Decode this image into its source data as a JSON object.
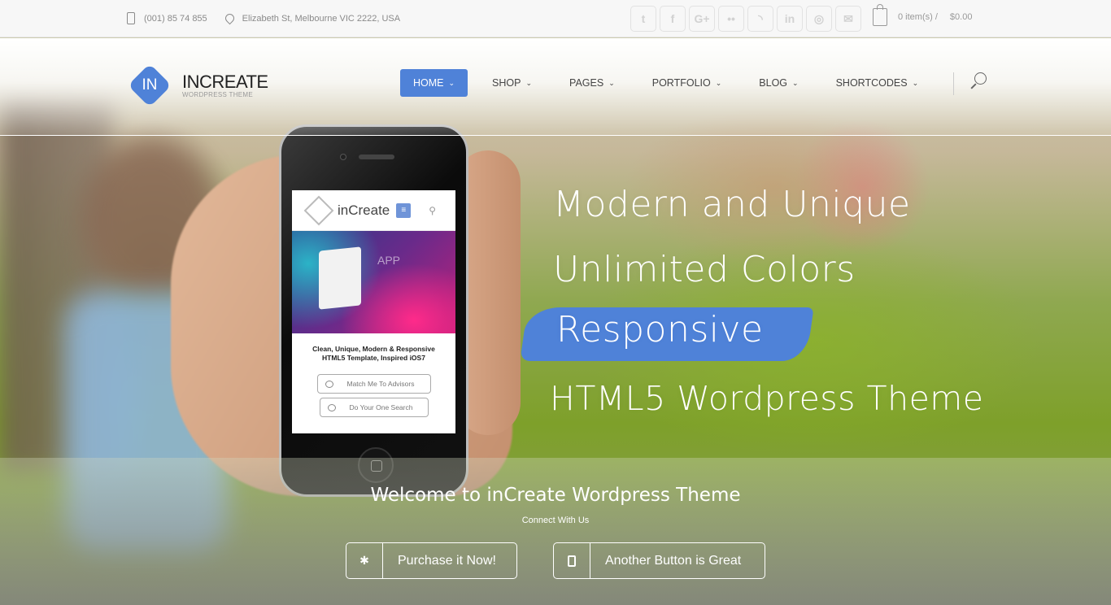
{
  "topbar": {
    "phone": "(001) 85 74 855",
    "address": "Elizabeth St, Melbourne VIC 2222, USA",
    "socials": [
      {
        "name": "twitter",
        "glyph": "t"
      },
      {
        "name": "facebook",
        "glyph": "f"
      },
      {
        "name": "google-plus",
        "glyph": "G+"
      },
      {
        "name": "flickr",
        "glyph": "••"
      },
      {
        "name": "rss",
        "glyph": "◝"
      },
      {
        "name": "linkedin",
        "glyph": "in"
      },
      {
        "name": "dribbble",
        "glyph": "◎"
      },
      {
        "name": "email",
        "glyph": "✉"
      }
    ],
    "cart_items": "0 item(s) /",
    "cart_total": "$0.00"
  },
  "header": {
    "logo_mark": "IN",
    "logo_title": "INCREATE",
    "logo_subtitle": "WORDPRESS THEME",
    "nav": [
      {
        "label": "HOME",
        "active": true
      },
      {
        "label": "SHOP"
      },
      {
        "label": "PAGES"
      },
      {
        "label": "PORTFOLIO"
      },
      {
        "label": "BLOG"
      },
      {
        "label": "SHORTCODES"
      }
    ],
    "chevron": "⌄"
  },
  "phone_screen": {
    "title": "inCreate",
    "menu_glyph": "≡",
    "search_glyph": "⚲",
    "banner_text": "APP",
    "tagline": "Clean, Unique, Modern & Responsive HTML5 Template, Inspired iOS7",
    "button1": "Match Me To Advisors",
    "button2": "Do Your One Search"
  },
  "hero": {
    "line1": "Modern and Unique",
    "line2": "Unlimited Colors",
    "line3": "Responsive",
    "line4": "HTML5 Wordpress Theme",
    "accent": "#4f82d8"
  },
  "band": {
    "welcome": "Welcome to inCreate Wordpress Theme",
    "connect": "Connect With Us",
    "button1": "Purchase it Now!",
    "button1_icon": "✱",
    "button2": "Another Button is Great"
  }
}
